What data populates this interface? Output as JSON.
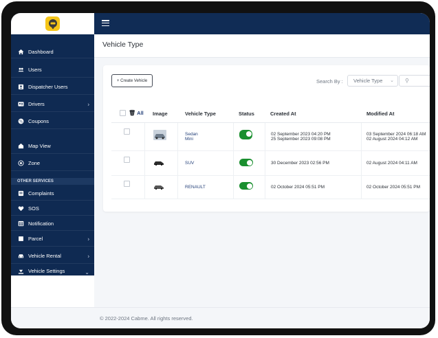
{
  "sidebar": {
    "items": [
      {
        "label": "Dashboard",
        "icon": "home-icon"
      },
      {
        "label": "Users",
        "icon": "users-icon"
      },
      {
        "label": "Dispatcher Users",
        "icon": "dispatcher-icon"
      },
      {
        "label": "Drivers",
        "icon": "driver-icon"
      },
      {
        "label": "Coupons",
        "icon": "coupon-icon"
      },
      {
        "label": "Map View",
        "icon": "map-icon"
      },
      {
        "label": "Zone",
        "icon": "zone-icon"
      }
    ],
    "section_label": "OTHER SERVICES",
    "other_items": [
      {
        "label": "Complaints",
        "icon": "complaint-icon"
      },
      {
        "label": "SOS",
        "icon": "sos-icon"
      },
      {
        "label": "Notification",
        "icon": "notification-icon"
      },
      {
        "label": "Parcel",
        "icon": "parcel-icon"
      },
      {
        "label": "Vehicle Rental",
        "icon": "car-icon"
      },
      {
        "label": "Vehicle Settings",
        "icon": "settings-icon"
      }
    ]
  },
  "header": {
    "page_title": "Vehicle Type"
  },
  "toolbar": {
    "create_label": "+ Create Vehicle",
    "search_by_label": "Search By :",
    "select_value": "Vehicle Type",
    "search_placeholder": ""
  },
  "table": {
    "headers": {
      "select_all": "All",
      "image": "Image",
      "vehicle_type": "Vehicle Type",
      "status": "Status",
      "created_at": "Created At",
      "modified_at": "Modified At"
    },
    "rows": [
      {
        "type_line1": "Sedan",
        "type_line2": "Mini",
        "created_line1": "02 September 2023 04:20 PM",
        "created_line2": "25 September 2023 09:08 PM",
        "modified_line1": "03 September 2024 06:18 AM",
        "modified_line2": "02 August 2024 04:12 AM",
        "status": "on"
      },
      {
        "type_line1": "SUV",
        "created_line1": "30 December 2023 02:56 PM",
        "modified_line1": "02 August 2024 04:11 AM",
        "status": "on"
      },
      {
        "type_line1": "RENAULT",
        "created_line1": "02 October 2024 05:51 PM",
        "modified_line1": "02 October 2024 05:51 PM",
        "status": "on"
      }
    ]
  },
  "footer": {
    "text": "© 2022-2024 Cabme. All rights reserved."
  },
  "colors": {
    "sidebar": "#0f2a52",
    "toggle_on": "#1a8f2f",
    "logo": "#f5c518"
  }
}
